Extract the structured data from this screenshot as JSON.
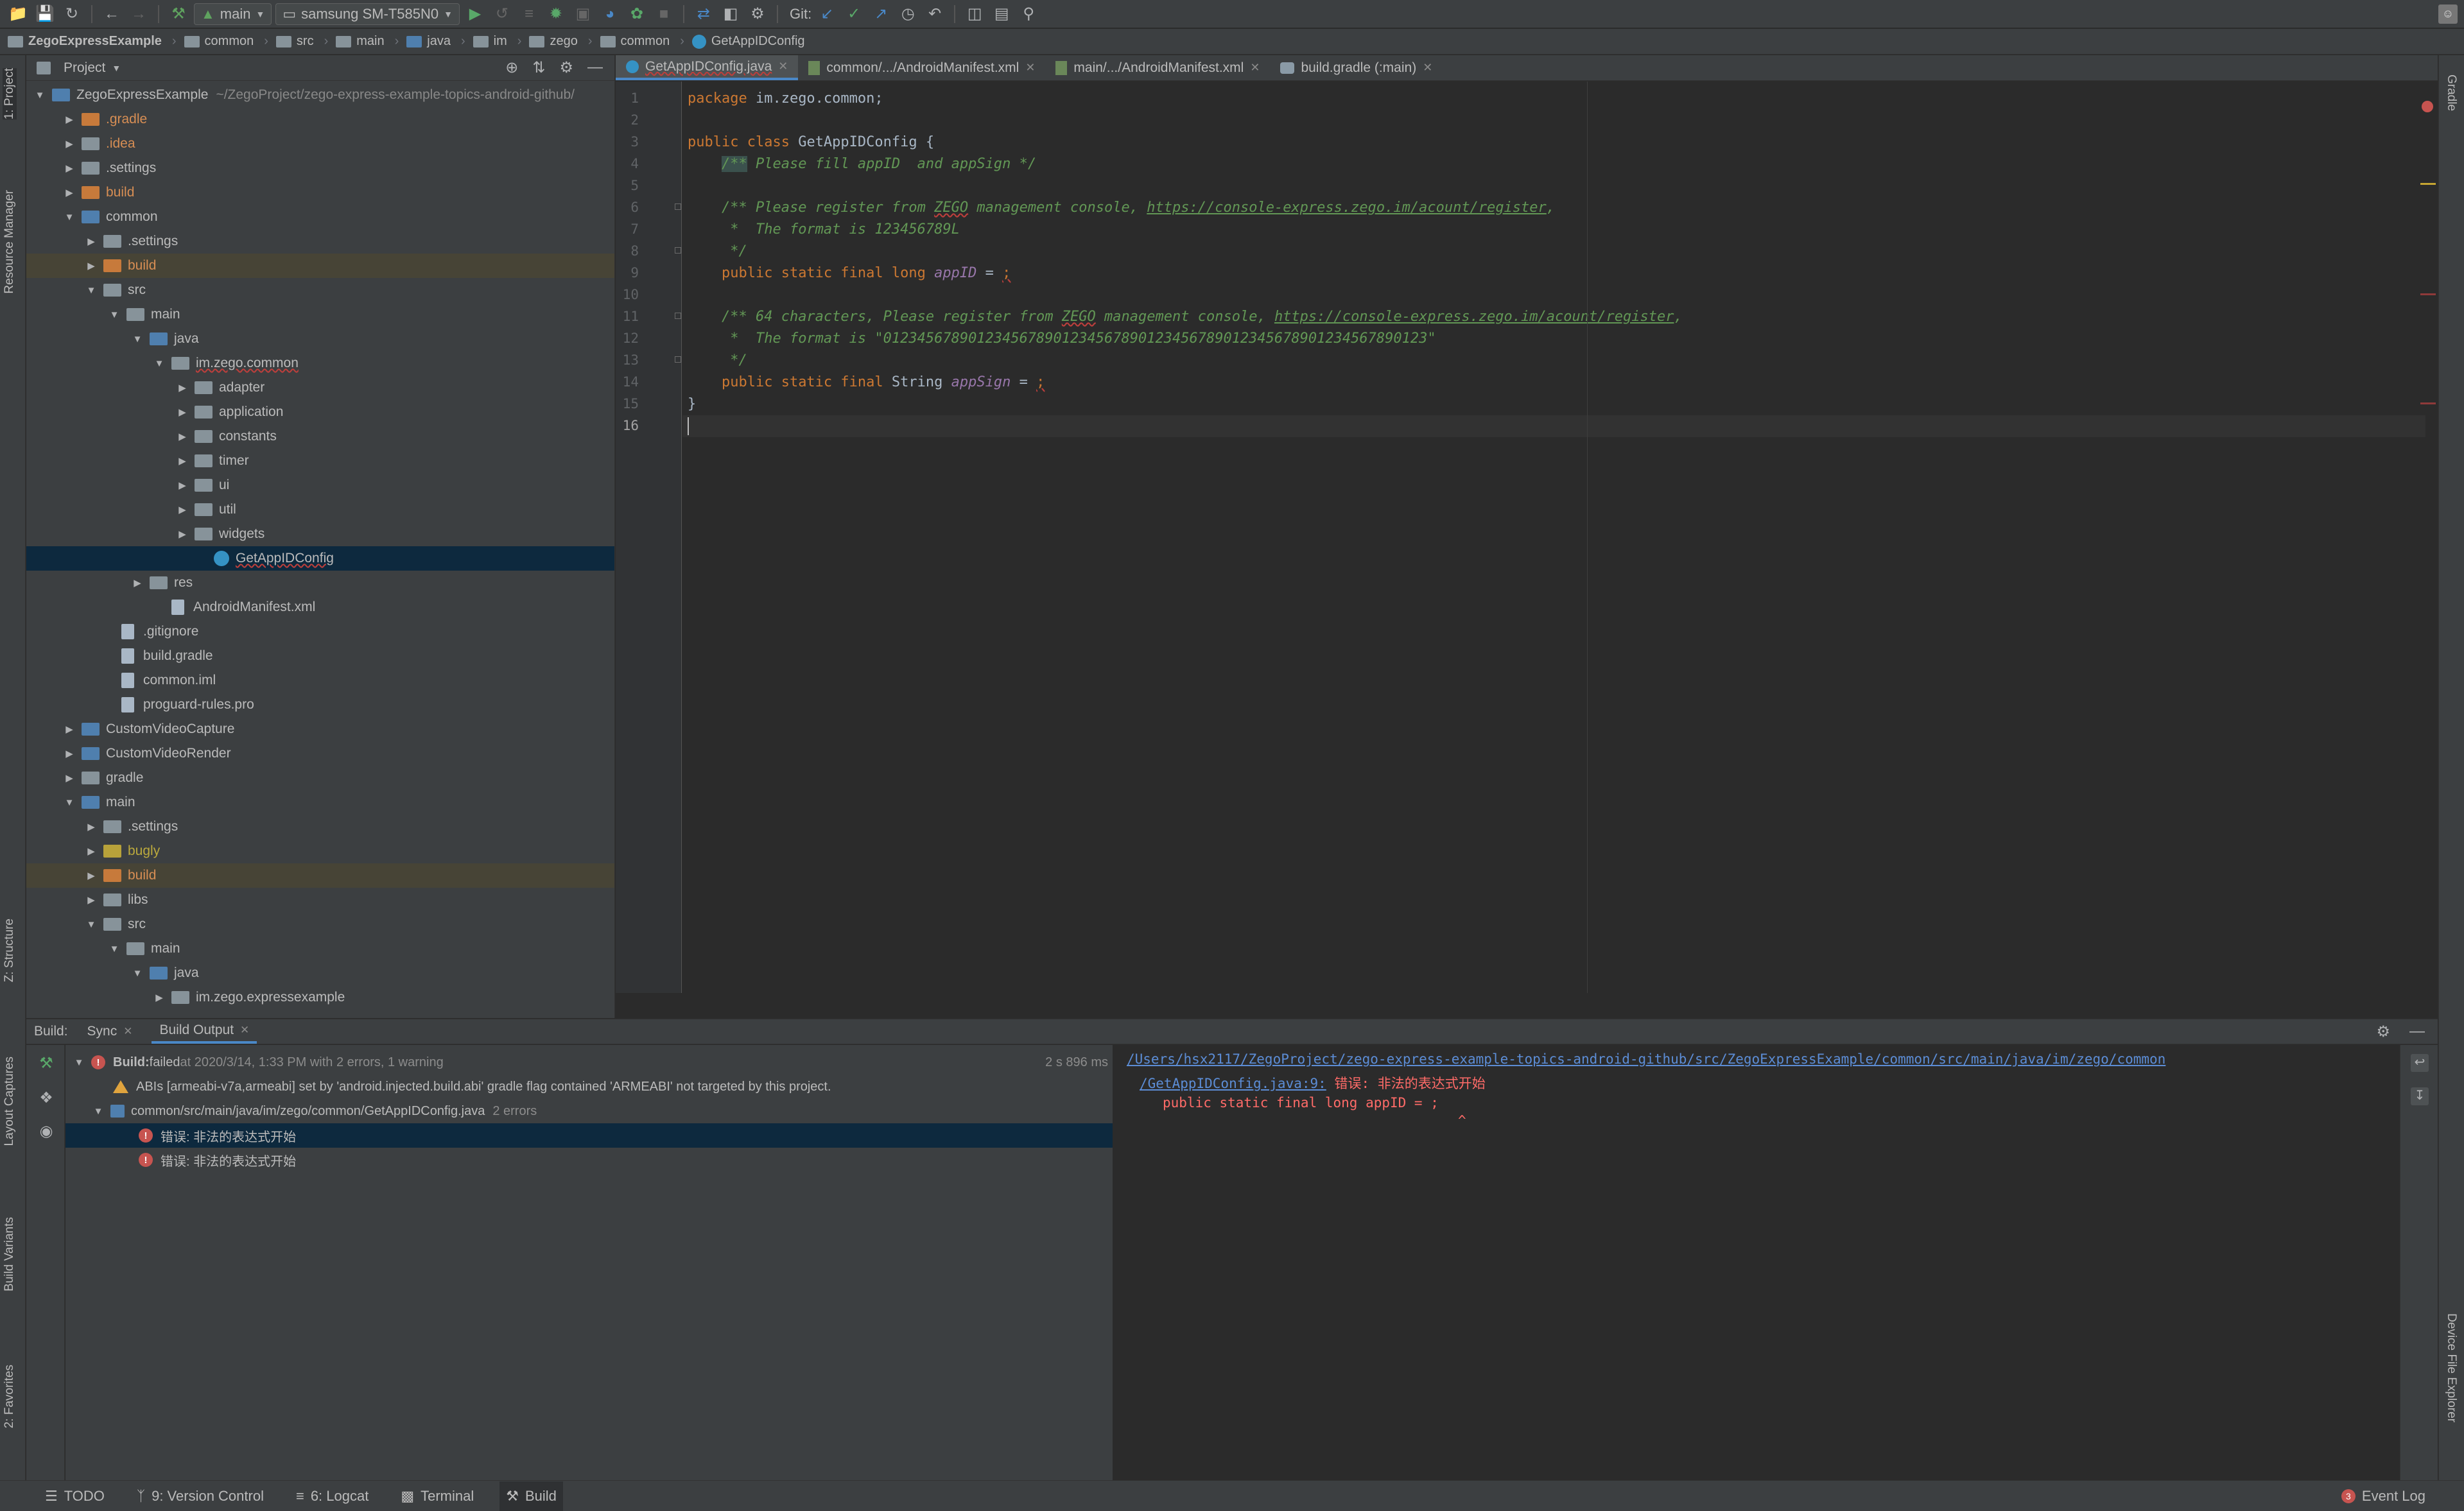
{
  "toolbar": {
    "run_config": "main",
    "device": "samsung SM-T585N0",
    "git_label": "Git:"
  },
  "breadcrumb": [
    "ZegoExpressExample",
    "common",
    "src",
    "main",
    "java",
    "im",
    "zego",
    "common",
    "GetAppIDConfig"
  ],
  "left_stripe": {
    "project": "1: Project",
    "resource_manager": "Resource Manager",
    "structure": "Z: Structure",
    "layout_captures": "Layout Captures",
    "build_variants": "Build Variants",
    "favorites": "2: Favorites"
  },
  "right_stripe": {
    "gradle": "Gradle",
    "device_explorer": "Device File Explorer"
  },
  "project_panel": {
    "title": "Project",
    "root_name": "ZegoExpressExample",
    "root_path": "~/ZegoProject/zego-express-example-topics-android-github/",
    "items": [
      ".gradle",
      ".idea",
      ".settings",
      "build",
      "common",
      ".settings",
      "build",
      "src",
      "main",
      "java",
      "im.zego.common",
      "adapter",
      "application",
      "constants",
      "timer",
      "ui",
      "util",
      "widgets",
      "GetAppIDConfig",
      "res",
      "AndroidManifest.xml",
      ".gitignore",
      "build.gradle",
      "common.iml",
      "proguard-rules.pro",
      "CustomVideoCapture",
      "CustomVideoRender",
      "gradle",
      "main",
      ".settings",
      "bugly",
      "build",
      "libs",
      "src",
      "main",
      "java",
      "im.zego.expressexample"
    ]
  },
  "editor": {
    "tabs": [
      "GetAppIDConfig.java",
      "common/.../AndroidManifest.xml",
      "main/.../AndroidManifest.xml",
      "build.gradle (:main)"
    ],
    "line_numbers": [
      "1",
      "2",
      "3",
      "4",
      "5",
      "6",
      "7",
      "8",
      "9",
      "10",
      "11",
      "12",
      "13",
      "14",
      "15",
      "16"
    ],
    "code": {
      "l1_kw": "package",
      "l1_rest": " im.zego.common;",
      "l3_kw": "public class",
      "l3_rest": " GetAppIDConfig {",
      "l4_open": "/**",
      "l4_rest": " Please fill appID  and appSign */",
      "l6_a": "/** Please register from ",
      "l6_b": "ZEGO",
      "l6_c": " management console, ",
      "l6_link": "https://console-express.zego.im/acount/register",
      "l6_d": ",",
      "l7": " *  The format is 123456789L",
      "l8": " */",
      "l9_kw": "public static final long",
      "l9_sp": " ",
      "l9_field": "appID",
      "l9_eq": " = ",
      "l9_end": ";",
      "l11_a": "/** 64 characters, Please register from ",
      "l11_b": "ZEGO",
      "l11_c": " management console, ",
      "l11_link": "https://console-express.zego.im/acount/register",
      "l11_d": ",",
      "l12": " *  The format is \"0123456789012345678901234567890123456789012345678901234567890123\"",
      "l13": " */",
      "l14_kw": "public static final",
      "l14_type": " String ",
      "l14_field": "appSign",
      "l14_eq": " = ",
      "l14_end": ";",
      "l15": "}"
    }
  },
  "build_panel": {
    "label": "Build:",
    "tabs": [
      "Sync",
      "Build Output"
    ],
    "status_bold": "Build:",
    "status_failed": " failed",
    "status_detail": " at 2020/3/14, 1:33 PM with 2 errors, 1 warning",
    "duration": "2 s 896 ms",
    "warning": "ABIs [armeabi-v7a,armeabi] set by 'android.injected.build.abi' gradle flag contained 'ARMEABI' not targeted by this project.",
    "file": "common/src/main/java/im/zego/common/GetAppIDConfig.java",
    "file_count": "2 errors",
    "errors": [
      "错误: 非法的表达式开始",
      "错误: 非法的表达式开始"
    ]
  },
  "build_output": {
    "path": "/Users/hsx2117/ZegoProject/zego-express-example-topics-android-github/src/ZegoExpressExample/common/src/main/java/im/zego/common",
    "file_link": "/GetAppIDConfig.java:9:",
    "error_msg": " 错误: 非法的表达式开始",
    "code_line": "public static final long appID = ;",
    "caret": "^"
  },
  "statusbar": {
    "todo": "TODO",
    "version_control": "9: Version Control",
    "logcat": "6: Logcat",
    "terminal": "Terminal",
    "build": "Build",
    "event_log": "Event Log",
    "event_count": "3"
  }
}
